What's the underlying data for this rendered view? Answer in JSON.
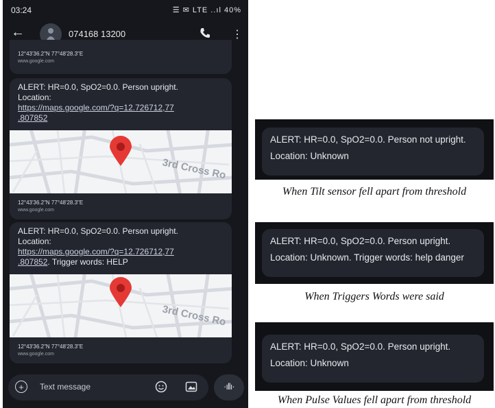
{
  "statusbar": {
    "time": "03:24",
    "icons": "☰ ✉ LTE ..ıl 40%",
    "battery_text": "40%"
  },
  "appbar": {
    "contact": "074168 13200"
  },
  "messages": [
    {
      "coords": "12°43'36.2\"N 77°48'28.3\"E",
      "site": "www.google.com"
    },
    {
      "line1": "ALERT: HR=0.0, SpO2=0.0. Person upright.",
      "line2": "Location:",
      "link1": "https://maps.google.com/?q=12.726712,77",
      "link2": ".807852",
      "map_label": "3rd Cross Ro",
      "coords": "12°43'36.2\"N 77°48'28.3\"E",
      "site": "www.google.com"
    },
    {
      "line1": "ALERT: HR=0.0, SpO2=0.0. Person upright.",
      "line2": "Location:",
      "link1": "https://maps.google.com/?q=12.726712,77",
      "link2": ".807852",
      "suffix": ". Trigger words: HELP",
      "map_label": "3rd Cross Ro",
      "coords": "12°43'36.2\"N 77°48'28.3\"E",
      "site": "www.google.com"
    }
  ],
  "input": {
    "placeholder": "Text message"
  },
  "panels": [
    {
      "line1": "ALERT: HR=0.0, SpO2=0.0. Person not upright.",
      "line2": "Location: Unknown",
      "caption": "When Tilt sensor fell apart from threshold"
    },
    {
      "line1": "ALERT: HR=0.0, SpO2=0.0. Person upright.",
      "line2": "Location: Unknown. Trigger words: help danger",
      "caption": "When Triggers Words were said"
    },
    {
      "line1": "ALERT: HR=0.0, SpO2=0.0. Person upright.",
      "line2": "Location: Unknown",
      "caption": "When Pulse Values fell apart from threshold"
    }
  ],
  "colors": {
    "phone_bg": "#15171c",
    "bubble_bg": "#23262e",
    "pin": "#e53935"
  }
}
